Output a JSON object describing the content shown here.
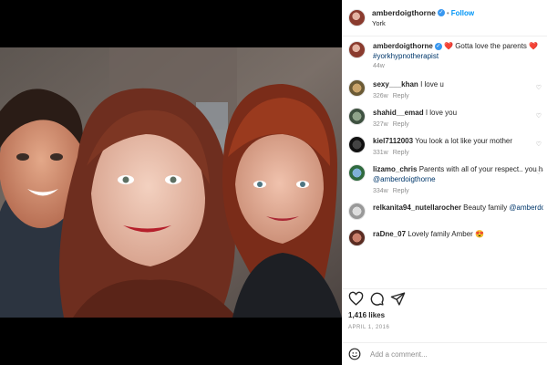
{
  "header": {
    "username": "amberdoigthorne",
    "follow_label": "Follow",
    "location": "York"
  },
  "caption": {
    "username": "amberdoigthorne",
    "text": "❤️ Gotta love the parents ❤️",
    "hashtag": "#yorkhypnotherapist",
    "time": "44w"
  },
  "comments": [
    {
      "user": "sexy___khan",
      "text": "I love u",
      "time": "326w",
      "reply": "Reply"
    },
    {
      "user": "shahid__emad",
      "text": "I love you",
      "time": "327w",
      "reply": "Reply"
    },
    {
      "user": "kiel7112003",
      "text": "You look a lot like your mother",
      "time": "331w",
      "reply": "Reply"
    },
    {
      "user": "lizamo_chris",
      "text": "Parents with all of your respect.. you have a beautiful daughter 😍😍😍... ",
      "mention": "@amberdoigthorne",
      "time": "334w",
      "reply": "Reply"
    },
    {
      "user": "relkanita94_nutellarocher",
      "text": "Beauty family ",
      "mention": "@amberdoigthorne",
      "time": "",
      "reply": ""
    },
    {
      "user": "raDne_07",
      "text": "Lovely family Amber 😍",
      "time": "",
      "reply": ""
    }
  ],
  "stats": {
    "likes": "1,416 likes",
    "date": "APRIL 1, 2016"
  },
  "add_comment": {
    "placeholder": "Add a comment..."
  },
  "icons": {
    "like": "heart-icon",
    "comment": "comment-icon",
    "share": "share-icon",
    "emoji": "emoji-icon",
    "verified": "verified-badge-icon"
  },
  "colors": {
    "accent": "#0095f6",
    "verified": "#3897f0",
    "heart": "#ed4956"
  }
}
